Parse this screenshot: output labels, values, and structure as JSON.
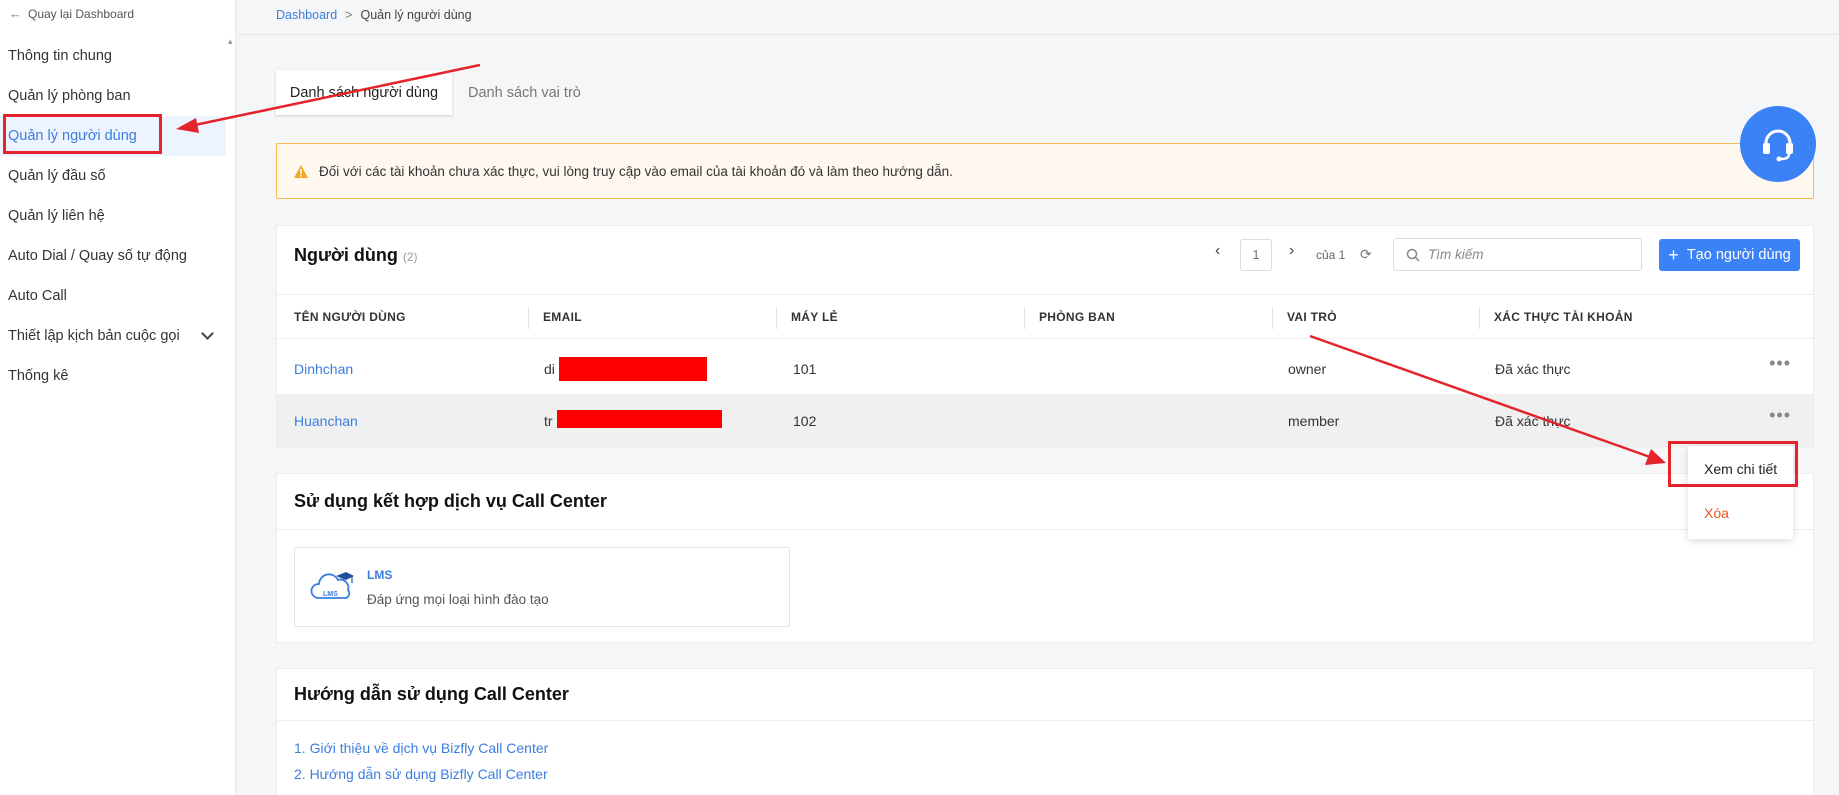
{
  "sidebar": {
    "back_label": "Quay lại Dashboard",
    "items": [
      {
        "label": "Thông tin chung"
      },
      {
        "label": "Quản lý phòng ban"
      },
      {
        "label": "Quản lý người dùng"
      },
      {
        "label": "Quản lý đầu số"
      },
      {
        "label": "Quản lý liên hệ"
      },
      {
        "label": "Auto Dial / Quay số tự động"
      },
      {
        "label": "Auto Call"
      },
      {
        "label": "Thiết lập kịch bản cuộc gọi"
      },
      {
        "label": "Thống kê"
      }
    ]
  },
  "breadcrumb": {
    "home": "Dashboard",
    "separator": ">",
    "current": "Quản lý người dùng"
  },
  "tabs": [
    {
      "label": "Danh sách người dùng"
    },
    {
      "label": "Danh sách vai trò"
    }
  ],
  "alert": {
    "text": "Đối với các tài khoản chưa xác thực, vui lòng truy cập vào email của tài khoản đó và làm theo hướng dẫn."
  },
  "users": {
    "title": "Người dùng",
    "count": "(2)",
    "pager": {
      "page": "1",
      "of": "của 1"
    },
    "search_placeholder": "Tìm kiếm",
    "create_label": "Tạo người dùng",
    "columns": [
      "TÊN NGƯỜI DÙNG",
      "EMAIL",
      "MÁY LẺ",
      "PHÒNG BAN",
      "VAI TRÒ",
      "XÁC THỰC TÀI KHOẢN"
    ],
    "rows": [
      {
        "name": "Dinhchan",
        "email_prefix": "di",
        "ext": "101",
        "dept": "",
        "role": "owner",
        "verify": "Đã xác thực"
      },
      {
        "name": "Huanchan",
        "email_prefix": "tr",
        "ext": "102",
        "dept": "",
        "role": "member",
        "verify": "Đã xác thực"
      }
    ],
    "more_glyph": "•••"
  },
  "services": {
    "title": "Sử dụng kết hợp dịch vụ Call Center",
    "lms_title": "LMS",
    "lms_desc": "Đáp ứng mọi loại hình đào tạo",
    "lms_icon_text": "LMS"
  },
  "guide": {
    "title": "Hướng dẫn sử dụng Call Center",
    "links": [
      "1. Giới thiệu về dịch vụ Bizfly Call Center",
      "2. Hướng dẫn sử dụng Bizfly Call Center"
    ]
  },
  "dropdown": {
    "view": "Xem chi tiết",
    "delete": "Xóa"
  },
  "colors": {
    "accent": "#3b82f6",
    "link": "#3b7ddd",
    "danger": "#f0541e",
    "annotation": "#e4242a"
  }
}
